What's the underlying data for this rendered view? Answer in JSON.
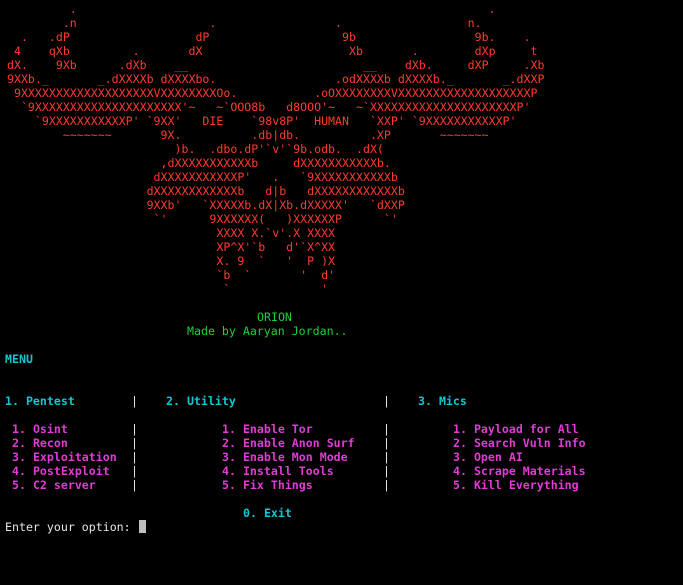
{
  "banner": {
    "art": "          .                                                           .\n         .n                   .                 .                  n.\n   .   .dP                  dP                   9b                 9b.    .\n  4    qXb         .       dX                     Xb       .        dXp     t\n dX.    9Xb      .dXb    __                         __    dXb.     dXP     .Xb\n 9XXb._       _.dXXXXb dXXXXbo.                 .odXXXXb dXXXXb._       _.dXXP\n  9XXXXXXXXXXXXXXXXXXXVXXXXXXXXOo.           .oOXXXXXXXXVXXXXXXXXXXXXXXXXXXXP\n   `9XXXXXXXXXXXXXXXXXXXXX'~   ~`OOO8b   d8OOO'~   ~`XXXXXXXXXXXXXXXXXXXXXP'\n     `9XXXXXXXXXXXP' `9XX'   DIE    `98v8P'  HUMAN   `XXP' `9XXXXXXXXXXXP'\n         ~~~~~~~       9X.          .db|db.          .XP       ~~~~~~~\n                         )b.  .dbo.dP'`v'`9b.odb.  .dX(\n                       ,dXXXXXXXXXXXb     dXXXXXXXXXXXb.\n                      dXXXXXXXXXXXP'   .   `9XXXXXXXXXXXb\n                     dXXXXXXXXXXXXb   d|b   dXXXXXXXXXXXXb\n                     9XXb'   `XXXXXb.dX|Xb.dXXXXX'   `dXXP\n                      `'      9XXXXXX(   )XXXXXXP      `'\n                               XXXX X.`v'.X XXXX\n                               XP^X'`b   d'`X^XX\n                               X. 9  `   '  P )X\n                               `b  `       '  d'\n                                `             '",
    "name": "ORION",
    "credit": "Made by Aaryan Jordan.."
  },
  "menu": {
    "title": "MENU",
    "columns": [
      {
        "heading": "1. Pentest",
        "items": [
          "1. Osint",
          "2. Recon",
          "3. Exploitation",
          "4. PostExploit",
          "5. C2 server"
        ]
      },
      {
        "heading": "2. Utility",
        "items": [
          "1. Enable Tor",
          "2. Enable Anon Surf",
          "3. Enable Mon Mode",
          "4. Install Tools",
          "5. Fix Things"
        ]
      },
      {
        "heading": "3. Mics",
        "items": [
          "1. Payload for All",
          "2. Search Vuln Info",
          "3. Open AI",
          "4. Scrape Materials",
          "5. Kill Everything"
        ]
      }
    ],
    "separator": "|",
    "exit": "0. Exit"
  },
  "prompt": {
    "label": "Enter your option: ",
    "value": ""
  },
  "colors": {
    "background": "#000000",
    "banner": "#ff3b2e",
    "credit": "#19d13a",
    "heading": "#13c6d6",
    "item": "#e23bd6",
    "text": "#e6e6e6"
  }
}
